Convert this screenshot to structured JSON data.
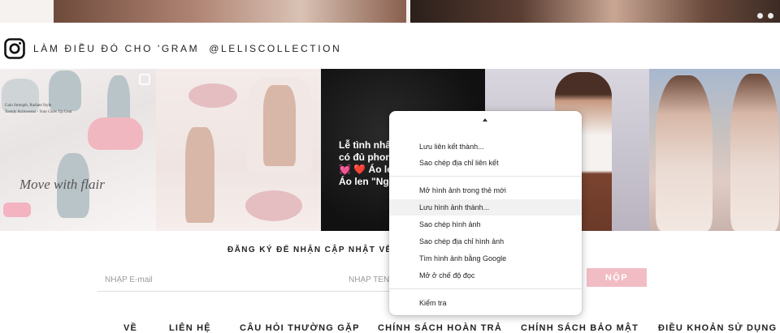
{
  "instagram": {
    "title": "LÀM ĐIỀU ĐÓ CHO 'GRAM",
    "handle": "@LELISCOLLECTION"
  },
  "gallery": {
    "tile1": {
      "script_text": "Move with flair",
      "small_lines": [
        "Gain Strength, Radiate Style",
        "Trendy Activewear - Your Glow Up Gear"
      ]
    },
    "tile3": {
      "caption_lines": [
        "Lễ tình nhân",
        "có đủ phong",
        "💓 ❤️ Áo len",
        "Áo len \"Người"
      ]
    }
  },
  "newsletter": {
    "title": "ĐĂNG KÝ ĐỂ NHẬN CẬP NHẬT VỀ TIN",
    "email_placeholder": "NHẬP E-mail",
    "name_placeholder": "NHẬP TÊN C",
    "submit_label": "NỘP"
  },
  "footer_nav": [
    "VỀ",
    "LIÊN HỆ",
    "CÂU HỎI THƯỜNG GẶP",
    "CHÍNH SÁCH HOÀN TRẢ",
    "CHÍNH SÁCH BẢO MẬT",
    "ĐIỀU KHOẢN SỬ DỤNG"
  ],
  "context_menu": {
    "items": [
      {
        "label": "Lưu liên kết thành..."
      },
      {
        "label": "Sao chép địa chỉ liên kết"
      },
      {
        "label": "Mở hình ảnh trong thẻ mới"
      },
      {
        "label": "Lưu hình ảnh thành...",
        "highlighted": true
      },
      {
        "label": "Sao chép hình ảnh"
      },
      {
        "label": "Sao chép địa chỉ hình ảnh"
      },
      {
        "label": "Tìm hình ảnh bằng Google"
      },
      {
        "label": "Mở ở chế độ đọc"
      },
      {
        "label": "Kiểm tra"
      }
    ]
  },
  "colors": {
    "submit_bg": "#f2bcc4",
    "menu_highlight": "#f1f1f1"
  },
  "icons": [
    "instagram-icon",
    "carousel-dot-icon",
    "caret-up-icon",
    "multi-image-icon"
  ]
}
